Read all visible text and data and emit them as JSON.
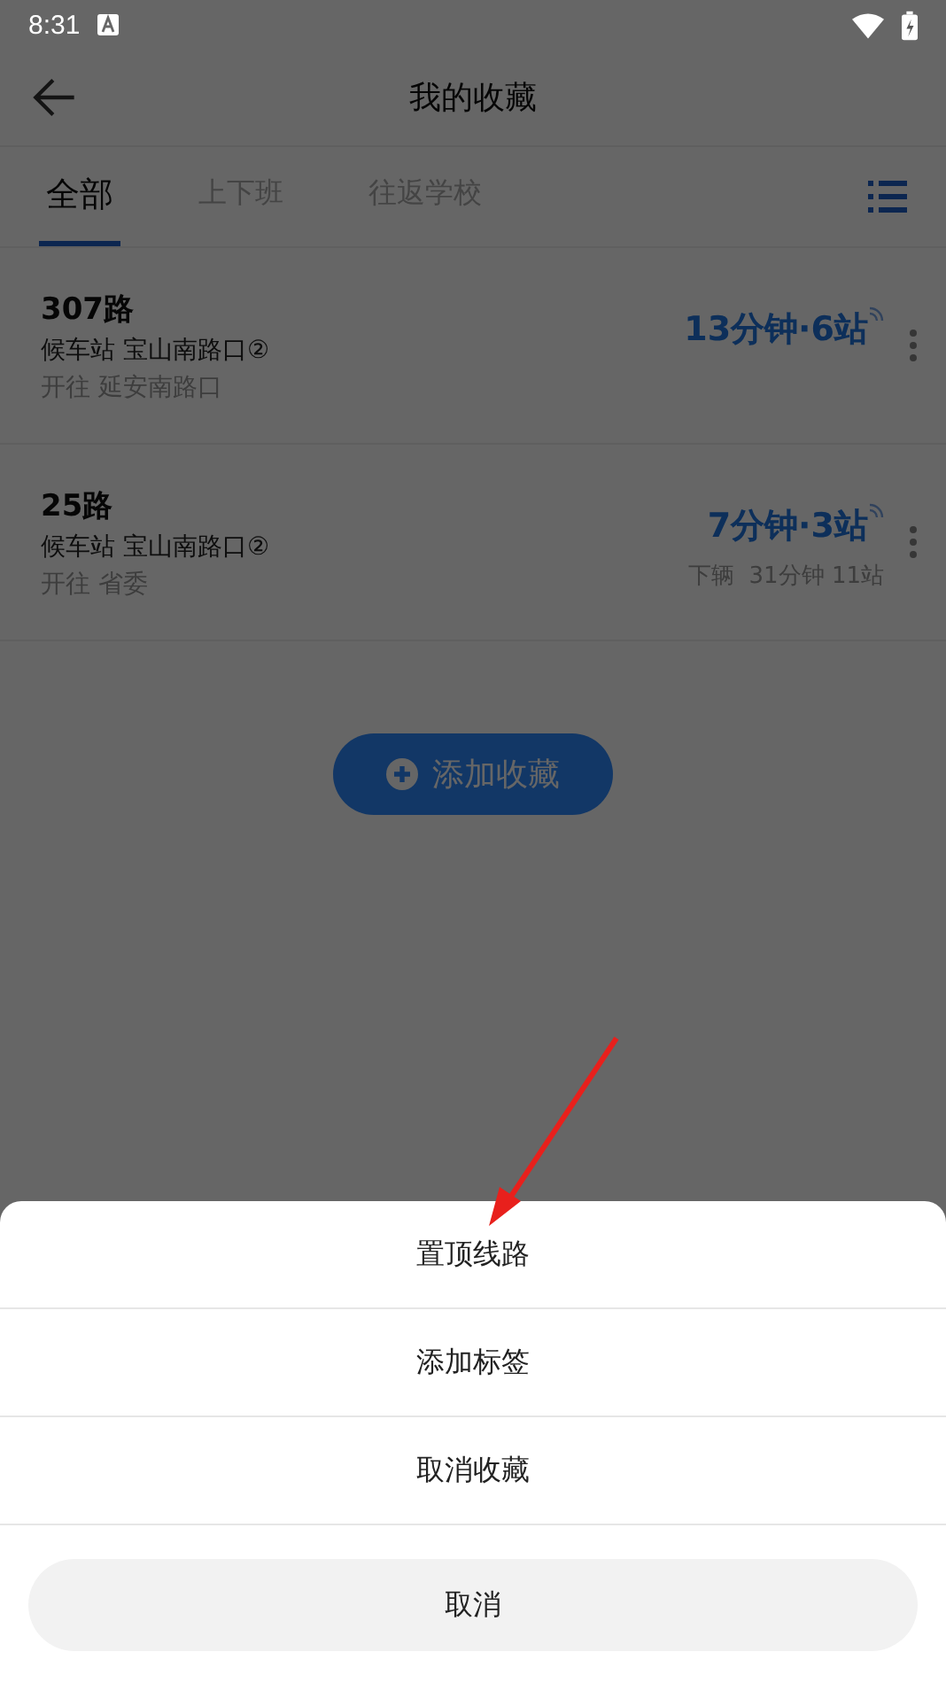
{
  "status_bar": {
    "time": "8:31"
  },
  "header": {
    "title": "我的收藏"
  },
  "tabs": [
    {
      "label": "全部",
      "selected": true
    },
    {
      "label": "上下班",
      "selected": false
    },
    {
      "label": "往返学校",
      "selected": false
    }
  ],
  "routes": [
    {
      "name": "307路",
      "stop": "候车站 宝山南路口②",
      "direction": "开往 延安南路口",
      "eta": "13分钟·6站"
    },
    {
      "name": "25路",
      "stop": "候车站 宝山南路口②",
      "direction": "开往 省委",
      "eta": "7分钟·3站",
      "next": "下辆  31分钟 11站"
    }
  ],
  "add_button": {
    "label": "添加收藏"
  },
  "action_sheet": {
    "options": [
      "置顶线路",
      "添加标签",
      "取消收藏"
    ],
    "cancel": "取消"
  }
}
